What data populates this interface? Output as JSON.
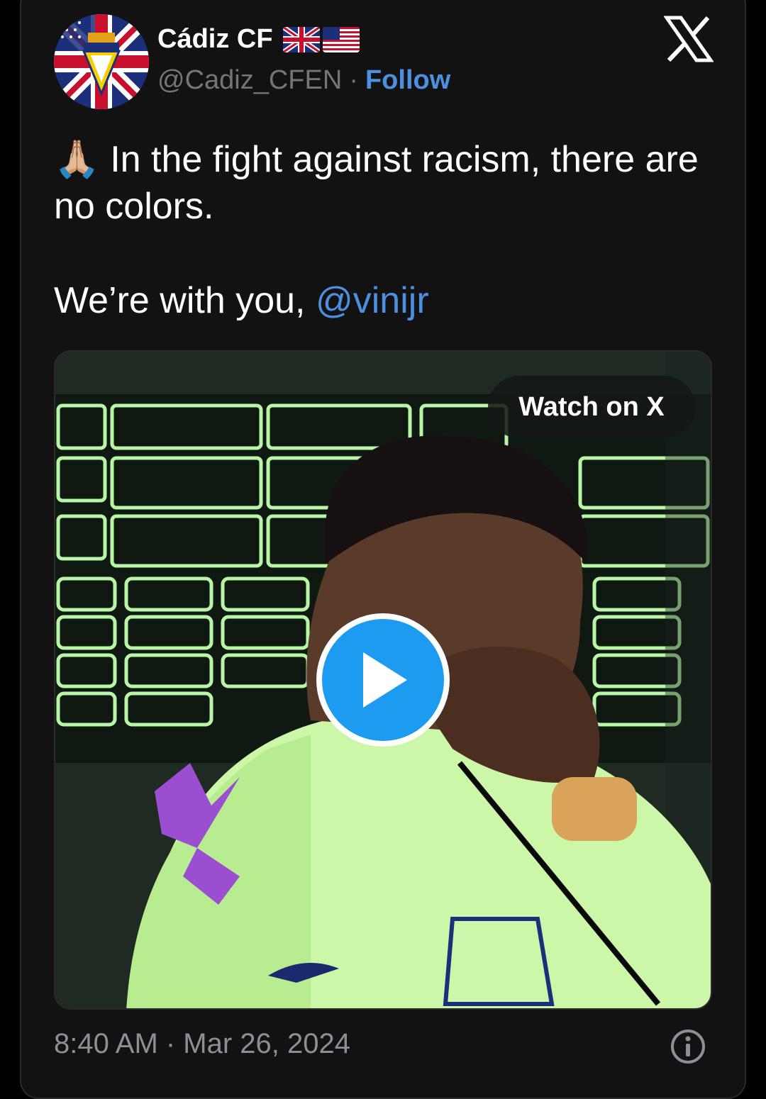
{
  "tweet": {
    "display_name": "Cádiz CF",
    "flags": [
      "uk-flag",
      "us-flag"
    ],
    "handle": "@Cadiz_CFEN",
    "separator": "·",
    "follow_label": "Follow",
    "emoji": "🙏🏼",
    "text_line1": "In the fight against racism, there are no colors.",
    "text_line2_prefix": "We’re with you, ",
    "mention": "@vinijr",
    "watch_label": "Watch on X",
    "timestamp": "8:40 AM · Mar 26, 2024",
    "icons": {
      "brand": "x-logo-icon",
      "play": "play-icon",
      "info": "info-icon"
    }
  },
  "colors": {
    "background": "#121212",
    "text": "#ffffff",
    "secondary_text": "#71767b",
    "link": "#4d8fe0",
    "play_button": "#1d9bf0"
  }
}
